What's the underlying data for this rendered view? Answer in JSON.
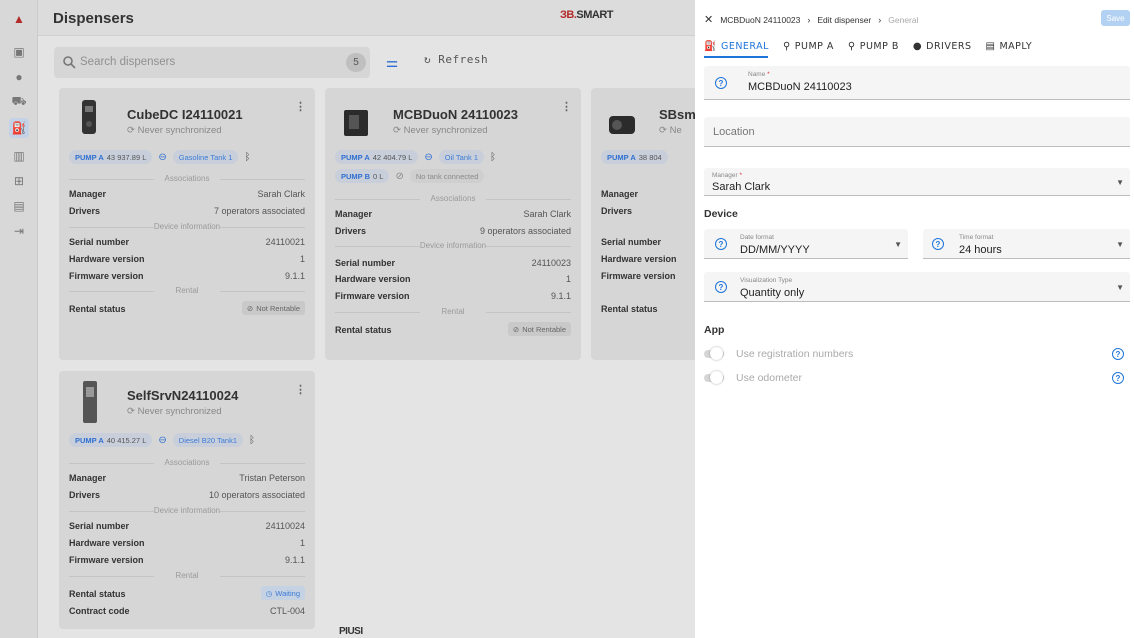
{
  "rail": {
    "icons": [
      "car-icon",
      "monitor-icon",
      "person-icon",
      "truck-icon",
      "dispenser-icon",
      "chart-icon",
      "grid-icon",
      "map-icon",
      "logout-icon"
    ]
  },
  "header": {
    "title": "Dispensers",
    "brand_a": "ЗB.",
    "brand_b": "SMART"
  },
  "toolbar": {
    "search_placeholder": "Search dispensers",
    "count": "5",
    "refresh_label": "Refresh"
  },
  "cards": [
    {
      "name": "CubeDC I24110021",
      "sync": "Never synchronized",
      "pumps": [
        {
          "label": "PUMP A",
          "qty": "43 937.89 L",
          "tank": "Gasoline Tank 1"
        }
      ],
      "associations_title": "Associations",
      "manager_label": "Manager",
      "manager": "Sarah Clark",
      "drivers_label": "Drivers",
      "drivers": "7 operators associated",
      "device_title": "Device information",
      "serial_label": "Serial number",
      "serial": "24110021",
      "hw_label": "Hardware version",
      "hw": "1",
      "fw_label": "Firmware version",
      "fw": "9.1.1",
      "rental_title": "Rental",
      "rental_label": "Rental status",
      "rental": "Not Rentable"
    },
    {
      "name": "MCBDuoN 24110023",
      "sync": "Never synchronized",
      "pumps": [
        {
          "label": "PUMP A",
          "qty": "42 404.79 L",
          "tank": "Oil Tank 1"
        },
        {
          "label": "PUMP B",
          "qty": "0 L",
          "tank": "No tank connected"
        }
      ],
      "associations_title": "Associations",
      "manager_label": "Manager",
      "manager": "Sarah Clark",
      "drivers_label": "Drivers",
      "drivers": "9 operators associated",
      "device_title": "Device information",
      "serial_label": "Serial number",
      "serial": "24110023",
      "hw_label": "Hardware version",
      "hw": "1",
      "fw_label": "Firmware version",
      "fw": "9.1.1",
      "rental_title": "Rental",
      "rental_label": "Rental status",
      "rental": "Not Rentable"
    },
    {
      "name": "SBsm",
      "sync": "Ne",
      "pumps": [
        {
          "label": "PUMP A",
          "qty": "38 804"
        }
      ],
      "manager_label": "Manager",
      "drivers_label": "Drivers",
      "serial_label": "Serial number",
      "hw_label": "Hardware version",
      "fw_label": "Firmware version",
      "rental_label": "Rental status"
    },
    {
      "name": "SelfSrvN24110024",
      "sync": "Never synchronized",
      "pumps": [
        {
          "label": "PUMP A",
          "qty": "40 415.27 L",
          "tank": "Diesel B20 Tank1"
        }
      ],
      "associations_title": "Associations",
      "manager_label": "Manager",
      "manager": "Tristan Peterson",
      "drivers_label": "Drivers",
      "drivers": "10 operators associated",
      "device_title": "Device information",
      "serial_label": "Serial number",
      "serial": "24110024",
      "hw_label": "Hardware version",
      "hw": "1",
      "fw_label": "Firmware version",
      "fw": "9.1.1",
      "rental_title": "Rental",
      "rental_label": "Rental status",
      "rental": "Waiting",
      "contract_label": "Contract code",
      "contract": "CTL-004"
    }
  ],
  "footer": {
    "brand": "PIUSI"
  },
  "drawer": {
    "breadcrumb": [
      "MCBDuoN 24110023",
      "Edit dispenser",
      "General"
    ],
    "save_label": "Save",
    "tabs": [
      "GENERAL",
      "PUMP A",
      "PUMP B",
      "DRIVERS",
      "MAPLY"
    ],
    "name_label": "Name",
    "name_value": "MCBDuoN 24110023",
    "location_placeholder": "Location",
    "manager_label": "Manager",
    "manager_value": "Sarah Clark",
    "device_title": "Device",
    "date_label": "Date format",
    "date_value": "DD/MM/YYYY",
    "time_label": "Time format",
    "time_value": "24 hours",
    "vis_label": "Visualization Type",
    "vis_value": "Quantity only",
    "app_title": "App",
    "toggle_reg": "Use registration numbers",
    "toggle_odo": "Use odometer"
  },
  "colors": {
    "accent": "#1e74d9",
    "required": "#d33333"
  }
}
